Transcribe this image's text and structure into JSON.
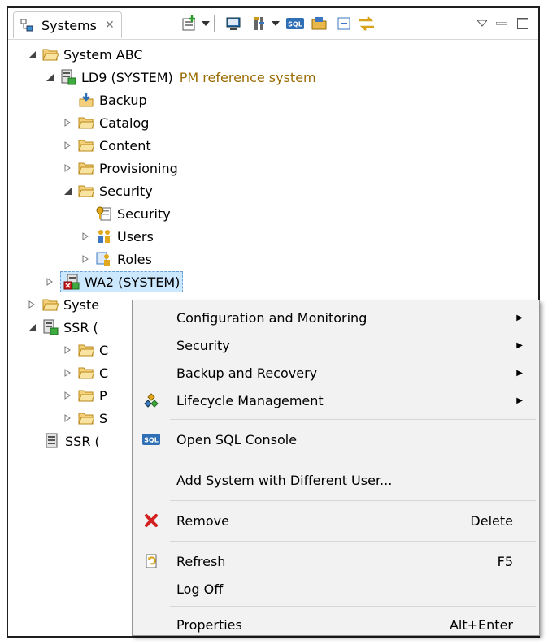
{
  "view": {
    "tab_label": "Systems",
    "tab_close_icon": "close-icon",
    "toolbar_icons": [
      "add-system-icon",
      "dropdown-arrow-icon",
      "console-icon",
      "tools-icon",
      "dropdown-arrow-icon",
      "sql-icon",
      "open-folder-icon",
      "collapse-all-icon",
      "link-editor-icon",
      "view-menu-icon",
      "minimize-icon",
      "maximize-icon"
    ]
  },
  "tree": {
    "system_abc": "System ABC",
    "ld9": "LD9 (SYSTEM)",
    "ld9_decoration": "PM reference system",
    "backup": "Backup",
    "catalog": "Catalog",
    "content": "Content",
    "provisioning": "Provisioning",
    "security_folder": "Security",
    "security_item": "Security",
    "users": "Users",
    "roles": "Roles",
    "wa2": "WA2 (SYSTEM)",
    "system_partial": "Syste",
    "ssr1": "SSR (",
    "ssr_child1": "C",
    "ssr_child2": "C",
    "ssr_child3": "P",
    "ssr_child4": "S",
    "ssr2": "SSR ("
  },
  "context_menu": {
    "configuration": "Configuration and Monitoring",
    "security": "Security",
    "backup_recovery": "Backup and Recovery",
    "lifecycle": "Lifecycle Management",
    "sql_console": "Open SQL Console",
    "add_system": "Add System with Different User...",
    "remove": "Remove",
    "remove_shortcut": "Delete",
    "refresh": "Refresh",
    "refresh_shortcut": "F5",
    "log_off": "Log Off",
    "properties": "Properties",
    "properties_shortcut": "Alt+Enter",
    "sql_icon_text": "SQL"
  },
  "colors": {
    "folder": "#e8b84a",
    "selection": "#cce8ff",
    "decoration": "#9a6b00",
    "remove_icon": "#d32020"
  }
}
